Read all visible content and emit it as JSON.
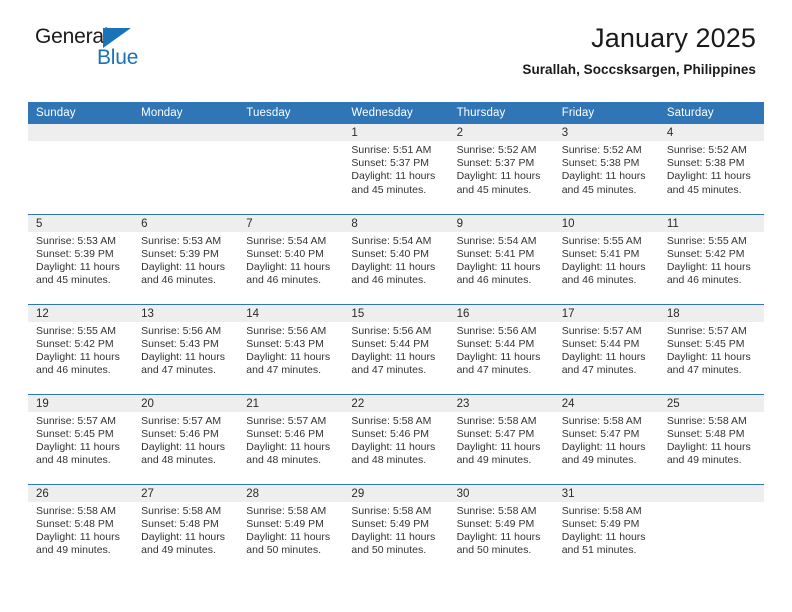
{
  "brand": {
    "name_part1": "General",
    "name_part2": "Blue",
    "triangle_icon": "triangle-icon",
    "accent_color": "#1a72b8"
  },
  "header": {
    "title": "January 2025",
    "subtitle": "Surallah, Soccsksargen, Philippines"
  },
  "theme": {
    "header_bg": "#3075b5",
    "daynum_bg": "#eeeeee",
    "text": "#333333"
  },
  "calendar": {
    "weekday_headers": [
      "Sunday",
      "Monday",
      "Tuesday",
      "Wednesday",
      "Thursday",
      "Friday",
      "Saturday"
    ],
    "weeks": [
      [
        {
          "day": "",
          "sunrise": "",
          "sunset": "",
          "daylight_line1": "",
          "daylight_line2": ""
        },
        {
          "day": "",
          "sunrise": "",
          "sunset": "",
          "daylight_line1": "",
          "daylight_line2": ""
        },
        {
          "day": "",
          "sunrise": "",
          "sunset": "",
          "daylight_line1": "",
          "daylight_line2": ""
        },
        {
          "day": "1",
          "sunrise": "Sunrise: 5:51 AM",
          "sunset": "Sunset: 5:37 PM",
          "daylight_line1": "Daylight: 11 hours",
          "daylight_line2": "and 45 minutes."
        },
        {
          "day": "2",
          "sunrise": "Sunrise: 5:52 AM",
          "sunset": "Sunset: 5:37 PM",
          "daylight_line1": "Daylight: 11 hours",
          "daylight_line2": "and 45 minutes."
        },
        {
          "day": "3",
          "sunrise": "Sunrise: 5:52 AM",
          "sunset": "Sunset: 5:38 PM",
          "daylight_line1": "Daylight: 11 hours",
          "daylight_line2": "and 45 minutes."
        },
        {
          "day": "4",
          "sunrise": "Sunrise: 5:52 AM",
          "sunset": "Sunset: 5:38 PM",
          "daylight_line1": "Daylight: 11 hours",
          "daylight_line2": "and 45 minutes."
        }
      ],
      [
        {
          "day": "5",
          "sunrise": "Sunrise: 5:53 AM",
          "sunset": "Sunset: 5:39 PM",
          "daylight_line1": "Daylight: 11 hours",
          "daylight_line2": "and 45 minutes."
        },
        {
          "day": "6",
          "sunrise": "Sunrise: 5:53 AM",
          "sunset": "Sunset: 5:39 PM",
          "daylight_line1": "Daylight: 11 hours",
          "daylight_line2": "and 46 minutes."
        },
        {
          "day": "7",
          "sunrise": "Sunrise: 5:54 AM",
          "sunset": "Sunset: 5:40 PM",
          "daylight_line1": "Daylight: 11 hours",
          "daylight_line2": "and 46 minutes."
        },
        {
          "day": "8",
          "sunrise": "Sunrise: 5:54 AM",
          "sunset": "Sunset: 5:40 PM",
          "daylight_line1": "Daylight: 11 hours",
          "daylight_line2": "and 46 minutes."
        },
        {
          "day": "9",
          "sunrise": "Sunrise: 5:54 AM",
          "sunset": "Sunset: 5:41 PM",
          "daylight_line1": "Daylight: 11 hours",
          "daylight_line2": "and 46 minutes."
        },
        {
          "day": "10",
          "sunrise": "Sunrise: 5:55 AM",
          "sunset": "Sunset: 5:41 PM",
          "daylight_line1": "Daylight: 11 hours",
          "daylight_line2": "and 46 minutes."
        },
        {
          "day": "11",
          "sunrise": "Sunrise: 5:55 AM",
          "sunset": "Sunset: 5:42 PM",
          "daylight_line1": "Daylight: 11 hours",
          "daylight_line2": "and 46 minutes."
        }
      ],
      [
        {
          "day": "12",
          "sunrise": "Sunrise: 5:55 AM",
          "sunset": "Sunset: 5:42 PM",
          "daylight_line1": "Daylight: 11 hours",
          "daylight_line2": "and 46 minutes."
        },
        {
          "day": "13",
          "sunrise": "Sunrise: 5:56 AM",
          "sunset": "Sunset: 5:43 PM",
          "daylight_line1": "Daylight: 11 hours",
          "daylight_line2": "and 47 minutes."
        },
        {
          "day": "14",
          "sunrise": "Sunrise: 5:56 AM",
          "sunset": "Sunset: 5:43 PM",
          "daylight_line1": "Daylight: 11 hours",
          "daylight_line2": "and 47 minutes."
        },
        {
          "day": "15",
          "sunrise": "Sunrise: 5:56 AM",
          "sunset": "Sunset: 5:44 PM",
          "daylight_line1": "Daylight: 11 hours",
          "daylight_line2": "and 47 minutes."
        },
        {
          "day": "16",
          "sunrise": "Sunrise: 5:56 AM",
          "sunset": "Sunset: 5:44 PM",
          "daylight_line1": "Daylight: 11 hours",
          "daylight_line2": "and 47 minutes."
        },
        {
          "day": "17",
          "sunrise": "Sunrise: 5:57 AM",
          "sunset": "Sunset: 5:44 PM",
          "daylight_line1": "Daylight: 11 hours",
          "daylight_line2": "and 47 minutes."
        },
        {
          "day": "18",
          "sunrise": "Sunrise: 5:57 AM",
          "sunset": "Sunset: 5:45 PM",
          "daylight_line1": "Daylight: 11 hours",
          "daylight_line2": "and 47 minutes."
        }
      ],
      [
        {
          "day": "19",
          "sunrise": "Sunrise: 5:57 AM",
          "sunset": "Sunset: 5:45 PM",
          "daylight_line1": "Daylight: 11 hours",
          "daylight_line2": "and 48 minutes."
        },
        {
          "day": "20",
          "sunrise": "Sunrise: 5:57 AM",
          "sunset": "Sunset: 5:46 PM",
          "daylight_line1": "Daylight: 11 hours",
          "daylight_line2": "and 48 minutes."
        },
        {
          "day": "21",
          "sunrise": "Sunrise: 5:57 AM",
          "sunset": "Sunset: 5:46 PM",
          "daylight_line1": "Daylight: 11 hours",
          "daylight_line2": "and 48 minutes."
        },
        {
          "day": "22",
          "sunrise": "Sunrise: 5:58 AM",
          "sunset": "Sunset: 5:46 PM",
          "daylight_line1": "Daylight: 11 hours",
          "daylight_line2": "and 48 minutes."
        },
        {
          "day": "23",
          "sunrise": "Sunrise: 5:58 AM",
          "sunset": "Sunset: 5:47 PM",
          "daylight_line1": "Daylight: 11 hours",
          "daylight_line2": "and 49 minutes."
        },
        {
          "day": "24",
          "sunrise": "Sunrise: 5:58 AM",
          "sunset": "Sunset: 5:47 PM",
          "daylight_line1": "Daylight: 11 hours",
          "daylight_line2": "and 49 minutes."
        },
        {
          "day": "25",
          "sunrise": "Sunrise: 5:58 AM",
          "sunset": "Sunset: 5:48 PM",
          "daylight_line1": "Daylight: 11 hours",
          "daylight_line2": "and 49 minutes."
        }
      ],
      [
        {
          "day": "26",
          "sunrise": "Sunrise: 5:58 AM",
          "sunset": "Sunset: 5:48 PM",
          "daylight_line1": "Daylight: 11 hours",
          "daylight_line2": "and 49 minutes."
        },
        {
          "day": "27",
          "sunrise": "Sunrise: 5:58 AM",
          "sunset": "Sunset: 5:48 PM",
          "daylight_line1": "Daylight: 11 hours",
          "daylight_line2": "and 49 minutes."
        },
        {
          "day": "28",
          "sunrise": "Sunrise: 5:58 AM",
          "sunset": "Sunset: 5:49 PM",
          "daylight_line1": "Daylight: 11 hours",
          "daylight_line2": "and 50 minutes."
        },
        {
          "day": "29",
          "sunrise": "Sunrise: 5:58 AM",
          "sunset": "Sunset: 5:49 PM",
          "daylight_line1": "Daylight: 11 hours",
          "daylight_line2": "and 50 minutes."
        },
        {
          "day": "30",
          "sunrise": "Sunrise: 5:58 AM",
          "sunset": "Sunset: 5:49 PM",
          "daylight_line1": "Daylight: 11 hours",
          "daylight_line2": "and 50 minutes."
        },
        {
          "day": "31",
          "sunrise": "Sunrise: 5:58 AM",
          "sunset": "Sunset: 5:49 PM",
          "daylight_line1": "Daylight: 11 hours",
          "daylight_line2": "and 51 minutes."
        },
        {
          "day": "",
          "sunrise": "",
          "sunset": "",
          "daylight_line1": "",
          "daylight_line2": ""
        }
      ]
    ]
  }
}
